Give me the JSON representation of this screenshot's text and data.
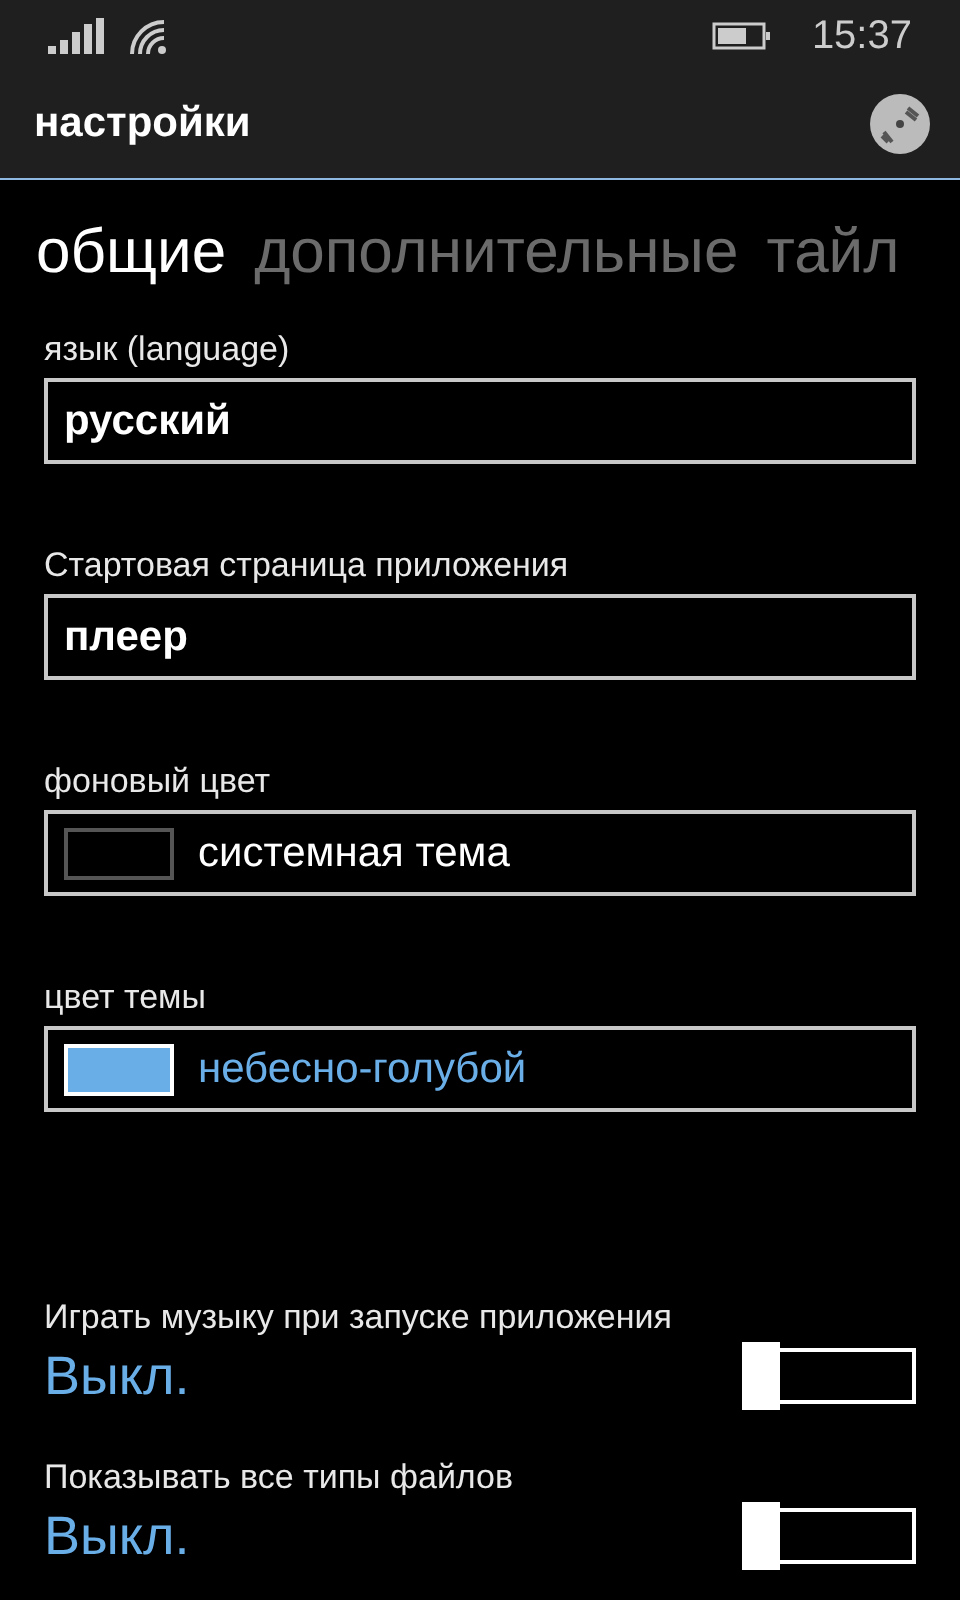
{
  "status_bar": {
    "time": "15:37"
  },
  "header": {
    "title": "настройки"
  },
  "tabs": [
    {
      "label": "общие",
      "selected": true
    },
    {
      "label": "дополнительные",
      "selected": false
    },
    {
      "label": "тайл",
      "selected": false
    }
  ],
  "fields": [
    {
      "kind": "text",
      "label": "язык (language)",
      "value": "русский"
    },
    {
      "kind": "text",
      "label": "Стартовая страница приложения",
      "value": "плеер"
    },
    {
      "kind": "color",
      "label": "фоновый цвет",
      "value": "системная тема",
      "color": "#000000",
      "accent": false
    },
    {
      "kind": "color",
      "label": "цвет темы",
      "value": "небесно-голубой",
      "color": "#6aaee8",
      "accent": true
    }
  ],
  "toggles": [
    {
      "label": "Играть музыку при запуске приложения",
      "value": "Выкл.",
      "on": false
    },
    {
      "label": "Показывать все типы файлов",
      "value": "Выкл.",
      "on": false
    }
  ]
}
